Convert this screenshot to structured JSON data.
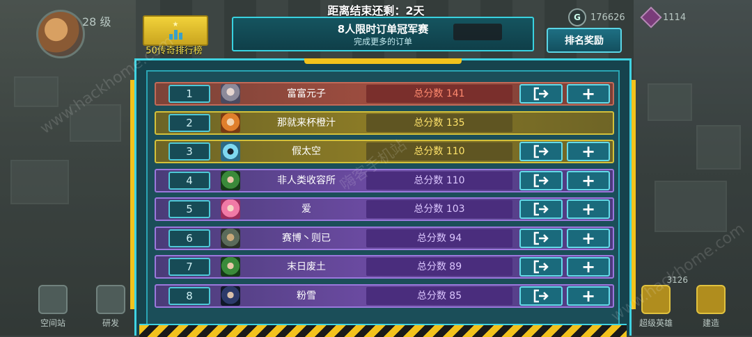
{
  "hud": {
    "level": "28 级",
    "gold": "176626",
    "gems": "1114",
    "countdown": "距离结束还剩：2天",
    "legend_badge": "50传奇排行榜"
  },
  "banner": {
    "title": "8人限时订单冠军赛",
    "subtitle": "完成更多的订单"
  },
  "reward_button": "排名奖励",
  "rows": [
    {
      "rank": "1",
      "name": "富富元子",
      "score": "总分数 141",
      "theme": "red",
      "has_actions": true,
      "avatar": "gray-haired-girl-avatar"
    },
    {
      "rank": "2",
      "name": "那就来杯橙汁",
      "score": "总分数 135",
      "theme": "gold",
      "has_actions": false,
      "avatar": "orange-hair-avatar"
    },
    {
      "rank": "3",
      "name": "假太空",
      "score": "总分数 110",
      "theme": "gold",
      "has_actions": true,
      "avatar": "robot-avatar"
    },
    {
      "rank": "4",
      "name": "非人类收容所",
      "score": "总分数 110",
      "theme": "purple",
      "has_actions": true,
      "avatar": "green-hair-avatar"
    },
    {
      "rank": "5",
      "name": "爱",
      "score": "总分数 103",
      "theme": "purple",
      "has_actions": true,
      "avatar": "pink-hair-avatar"
    },
    {
      "rank": "6",
      "name": "赛博丶则已",
      "score": "总分数 94",
      "theme": "purple",
      "has_actions": true,
      "avatar": "masked-avatar"
    },
    {
      "rank": "7",
      "name": "末日废土",
      "score": "总分数 89",
      "theme": "purple",
      "has_actions": true,
      "avatar": "green-hair-avatar"
    },
    {
      "rank": "8",
      "name": "粉雪",
      "score": "总分数 85",
      "theme": "purple",
      "has_actions": true,
      "avatar": "dark-hair-avatar"
    }
  ],
  "bottom_nav": {
    "space_station": "空间站",
    "research": "研发",
    "super_hero": "超级英雄",
    "build": "建造",
    "side_value": "3126"
  },
  "watermark": "www.hackhome.com",
  "watermark_cn": "嗨客手机站",
  "colors": {
    "panel_border": "#3fd3e2",
    "accent_yellow": "#f2c21c",
    "row_red": "#9b4c3f",
    "row_gold": "#8a7a26",
    "row_purple": "#6a4aa0"
  }
}
